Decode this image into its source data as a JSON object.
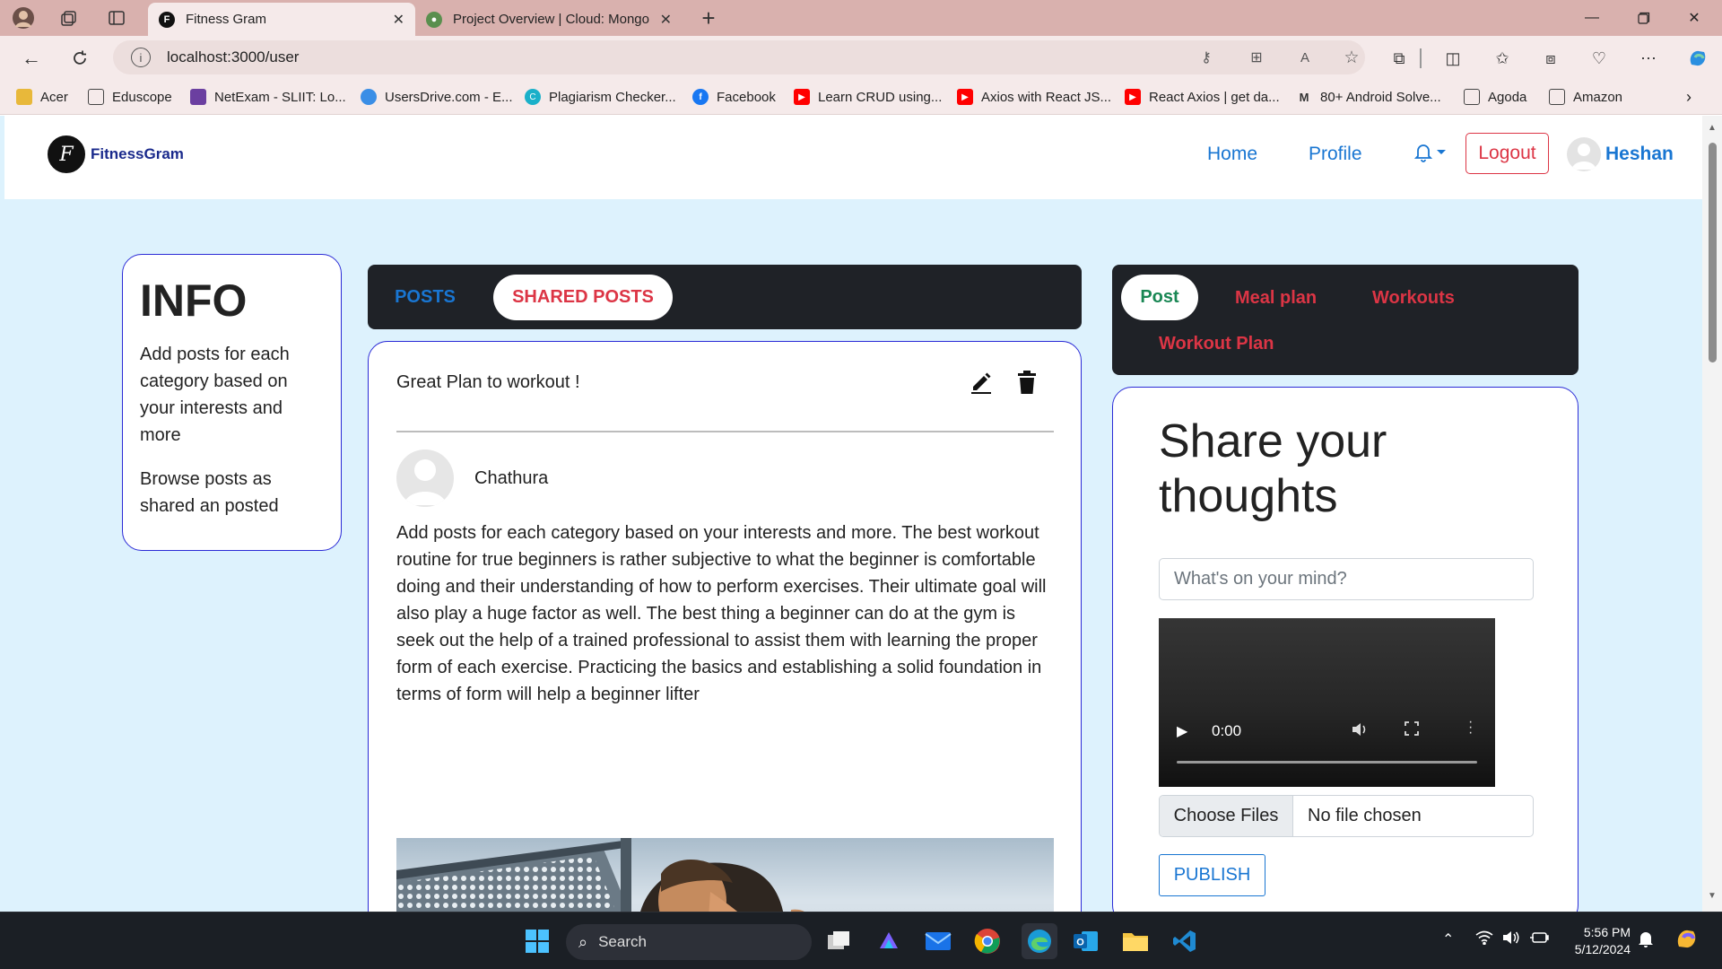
{
  "browser": {
    "tabs": [
      {
        "title": "Fitness Gram",
        "active": true
      },
      {
        "title": "Project Overview | Cloud: Mongo",
        "active": false
      }
    ],
    "url": "localhost:3000/user",
    "bookmarks": [
      {
        "label": "Acer",
        "icon": "folder-icon",
        "color": "#e8b83a"
      },
      {
        "label": "Eduscope",
        "icon": "page-icon",
        "color": "#444444"
      },
      {
        "label": "NetExam - SLIIT: Lo...",
        "icon": "netexam-icon",
        "color": "#6b3fa0"
      },
      {
        "label": "UsersDrive.com - E...",
        "icon": "drive-icon",
        "color": "#3a8ee6"
      },
      {
        "label": "Plagiarism Checker...",
        "icon": "plagiarism-icon",
        "color": "#1ab0c9"
      },
      {
        "label": "Facebook",
        "icon": "facebook-icon",
        "color": "#1877f2"
      },
      {
        "label": "Learn CRUD using...",
        "icon": "youtube-icon",
        "color": "#ff0000"
      },
      {
        "label": "Axios with React JS...",
        "icon": "youtube-icon",
        "color": "#ff0000"
      },
      {
        "label": "React Axios | get da...",
        "icon": "youtube-icon",
        "color": "#ff0000"
      },
      {
        "label": "80+ Android Solve...",
        "icon": "medium-icon",
        "color": "#333333"
      },
      {
        "label": "Agoda",
        "icon": "page-icon",
        "color": "#444444"
      },
      {
        "label": "Amazon",
        "icon": "page-icon",
        "color": "#444444"
      }
    ]
  },
  "navbar": {
    "brand": "FitnessGram",
    "links": [
      "Home",
      "Profile"
    ],
    "logout_label": "Logout",
    "user_name": "Heshan"
  },
  "info": {
    "heading": "INFO",
    "para1": "Add posts for each category based on your interests and more",
    "para2": "Browse posts as shared an posted"
  },
  "feed_tabs": [
    {
      "label": "POSTS",
      "active": false
    },
    {
      "label": "SHARED POSTS",
      "active": true
    }
  ],
  "post": {
    "title": "Great Plan to workout !",
    "author": "Chathura",
    "body": "Add posts for each category based on your interests and more. The best workout routine for true beginners is rather subjective to what the beginner is comfortable doing and their understanding of how to perform exercises. Their ultimate goal will also play a huge factor as well. The best thing a beginner can do at the gym is seek out the help of a trained professional to assist them with learning the proper form of each exercise. Practicing the basics and establishing a solid foundation in terms of form will help a beginner lifter"
  },
  "category_tabs": [
    {
      "label": "Post",
      "active": true
    },
    {
      "label": "Meal plan",
      "active": false
    },
    {
      "label": "Workouts",
      "active": false
    },
    {
      "label": "Workout Plan",
      "active": false
    }
  ],
  "share": {
    "heading": "Share your thoughts",
    "placeholder": "What's on your mind?",
    "video_time": "0:00",
    "choose_files": "Choose Files",
    "no_file": "No file chosen",
    "publish": "PUBLISH"
  },
  "taskbar": {
    "search_label": "Search",
    "time": "5:56 PM",
    "date": "5/12/2024"
  },
  "colors": {
    "page_bg": "#ddf2fd",
    "accent_blue": "#1976d2",
    "danger_red": "#dc3545",
    "success_green": "#198754",
    "card_border": "#2b2bd6",
    "dark_tabs": "#1f2227"
  }
}
